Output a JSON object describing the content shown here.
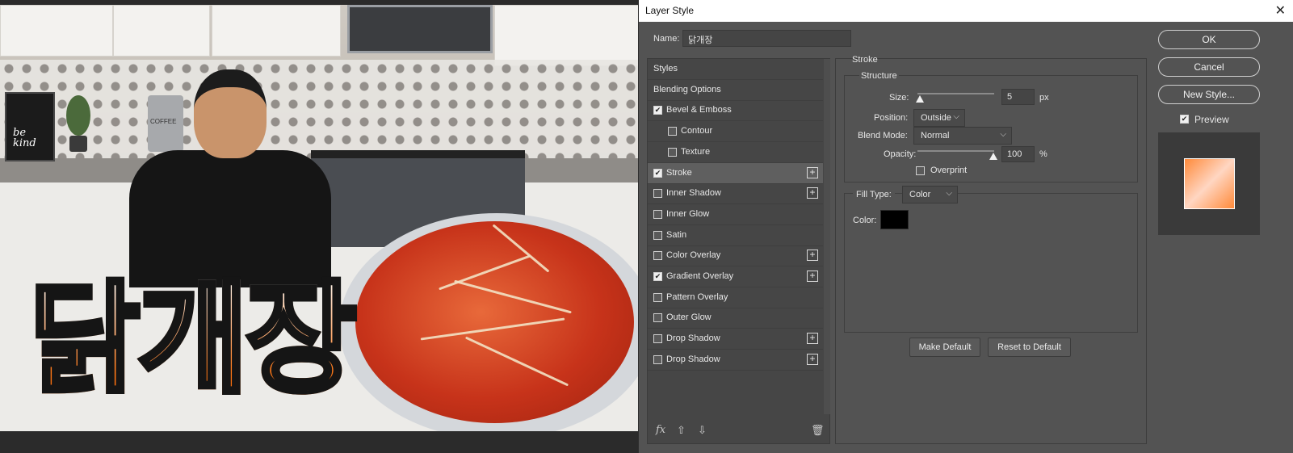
{
  "canvas": {
    "title_text": "닭개장",
    "sign_text": "be kind",
    "canister_text": "COFFEE"
  },
  "dialog": {
    "title": "Layer Style",
    "close_icon": "close-icon",
    "name_label": "Name:",
    "name_value": "닭개장"
  },
  "styles": {
    "items": [
      {
        "label": "Styles",
        "checkbox": false,
        "checked": false,
        "plus": false,
        "indent": false
      },
      {
        "label": "Blending Options",
        "checkbox": false,
        "checked": false,
        "plus": false,
        "indent": false
      },
      {
        "label": "Bevel & Emboss",
        "checkbox": true,
        "checked": true,
        "plus": false,
        "indent": false
      },
      {
        "label": "Contour",
        "checkbox": true,
        "checked": false,
        "plus": false,
        "indent": true
      },
      {
        "label": "Texture",
        "checkbox": true,
        "checked": false,
        "plus": false,
        "indent": true
      },
      {
        "label": "Stroke",
        "checkbox": true,
        "checked": true,
        "plus": true,
        "indent": false
      },
      {
        "label": "Inner Shadow",
        "checkbox": true,
        "checked": false,
        "plus": true,
        "indent": false
      },
      {
        "label": "Inner Glow",
        "checkbox": true,
        "checked": false,
        "plus": false,
        "indent": false
      },
      {
        "label": "Satin",
        "checkbox": true,
        "checked": false,
        "plus": false,
        "indent": false
      },
      {
        "label": "Color Overlay",
        "checkbox": true,
        "checked": false,
        "plus": true,
        "indent": false
      },
      {
        "label": "Gradient Overlay",
        "checkbox": true,
        "checked": true,
        "plus": true,
        "indent": false
      },
      {
        "label": "Pattern Overlay",
        "checkbox": true,
        "checked": false,
        "plus": false,
        "indent": false
      },
      {
        "label": "Outer Glow",
        "checkbox": true,
        "checked": false,
        "plus": false,
        "indent": false
      },
      {
        "label": "Drop Shadow",
        "checkbox": true,
        "checked": false,
        "plus": true,
        "indent": false
      },
      {
        "label": "Drop Shadow",
        "checkbox": true,
        "checked": false,
        "plus": true,
        "indent": false
      }
    ],
    "footer": {
      "fx": "fx",
      "up_icon": "arrow-up-icon",
      "down_icon": "arrow-down-icon",
      "trash_icon": "trash-icon"
    }
  },
  "stroke": {
    "section_title": "Stroke",
    "structure_title": "Structure",
    "size_label": "Size:",
    "size_value": "5",
    "size_unit": "px",
    "position_label": "Position:",
    "position_value": "Outside",
    "blend_label": "Blend Mode:",
    "blend_value": "Normal",
    "opacity_label": "Opacity:",
    "opacity_value": "100",
    "opacity_unit": "%",
    "overprint_label": "Overprint",
    "overprint_checked": false,
    "filltype_label": "Fill Type:",
    "filltype_value": "Color",
    "color_label": "Color:",
    "color_hex": "#000000",
    "make_default": "Make Default",
    "reset_default": "Reset to Default"
  },
  "buttons": {
    "ok": "OK",
    "cancel": "Cancel",
    "new_style": "New Style...",
    "preview_label": "Preview",
    "preview_checked": true
  }
}
